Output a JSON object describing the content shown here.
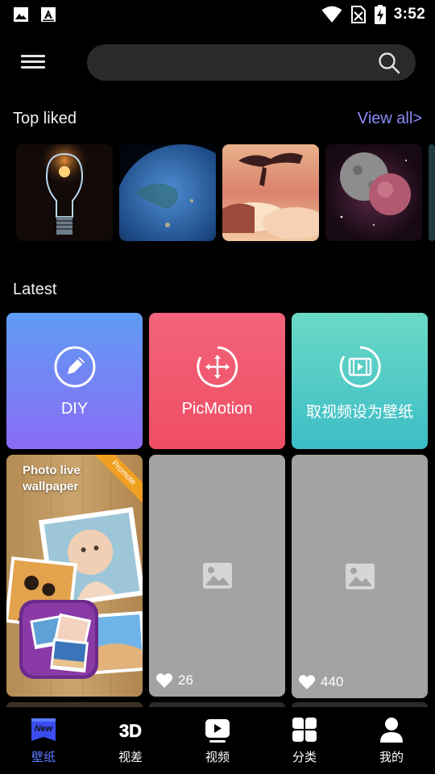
{
  "status_bar": {
    "time": "3:52",
    "icons": [
      "image-icon",
      "text-a-icon",
      "wifi-icon",
      "no-sim-icon",
      "battery-charging-icon"
    ]
  },
  "header": {
    "menu_icon": "hamburger-icon",
    "search": {
      "placeholder": "",
      "icon": "search-icon"
    }
  },
  "top_liked": {
    "title": "Top liked",
    "view_all": "View all>",
    "thumbnails": [
      "light-bulb",
      "earth-at-night",
      "floating-island-clouds",
      "moon-and-planet",
      "partial-next"
    ]
  },
  "latest": {
    "title": "Latest",
    "features": [
      {
        "label": "DIY",
        "icon": "pencil-icon",
        "gradient": [
          "#5f9cf4",
          "#8a6cf5"
        ]
      },
      {
        "label": "PicMotion",
        "icon": "move-arrows-icon",
        "gradient": [
          "#f2637a",
          "#ef4e63"
        ]
      },
      {
        "label": "取视频设为壁纸",
        "icon": "video-film-icon",
        "gradient": [
          "#6bd9c6",
          "#3dbdc6"
        ]
      }
    ],
    "promo": {
      "title": "Photo live wallpaper",
      "ribbon": "Promote"
    },
    "wallpapers": [
      {
        "likes": "26",
        "icon": "image-placeholder-icon"
      },
      {
        "likes": "440",
        "icon": "image-placeholder-icon"
      }
    ]
  },
  "bottom_nav": {
    "active_color": "#5a7bff",
    "items": [
      {
        "label": "壁纸",
        "icon": "new-badge-icon",
        "active": true
      },
      {
        "label": "视差",
        "icon": "3d-icon",
        "active": false
      },
      {
        "label": "视频",
        "icon": "play-icon",
        "active": false
      },
      {
        "label": "分类",
        "icon": "categories-icon",
        "active": false
      },
      {
        "label": "我的",
        "icon": "profile-icon",
        "active": false
      }
    ]
  }
}
